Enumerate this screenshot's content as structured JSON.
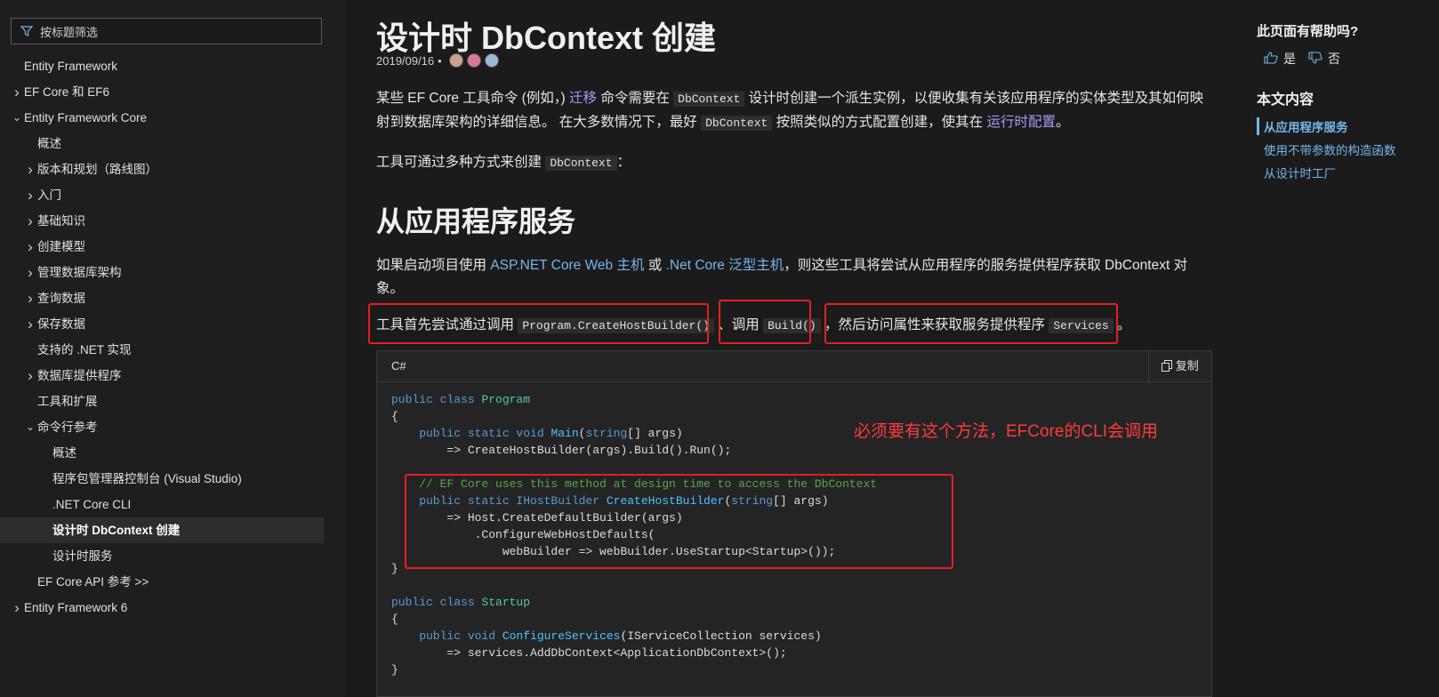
{
  "filter": {
    "placeholder": "按标题筛选",
    "icon": "filter-icon"
  },
  "nav": [
    {
      "label": "Entity Framework",
      "level": 0,
      "chevron": ""
    },
    {
      "label": "EF Core 和 EF6",
      "level": 0,
      "chevron": "right"
    },
    {
      "label": "Entity Framework Core",
      "level": 0,
      "chevron": "down"
    },
    {
      "label": "概述",
      "level": 1,
      "chevron": ""
    },
    {
      "label": "版本和规划（路线图）",
      "level": 1,
      "chevron": "right"
    },
    {
      "label": "入门",
      "level": 1,
      "chevron": "right"
    },
    {
      "label": "基础知识",
      "level": 1,
      "chevron": "right"
    },
    {
      "label": "创建模型",
      "level": 1,
      "chevron": "right"
    },
    {
      "label": "管理数据库架构",
      "level": 1,
      "chevron": "right"
    },
    {
      "label": "查询数据",
      "level": 1,
      "chevron": "right"
    },
    {
      "label": "保存数据",
      "level": 1,
      "chevron": "right"
    },
    {
      "label": "支持的 .NET 实现",
      "level": 1,
      "chevron": ""
    },
    {
      "label": "数据库提供程序",
      "level": 1,
      "chevron": "right"
    },
    {
      "label": "工具和扩展",
      "level": 1,
      "chevron": ""
    },
    {
      "label": "命令行参考",
      "level": 1,
      "chevron": "down"
    },
    {
      "label": "概述",
      "level": 2,
      "chevron": ""
    },
    {
      "label": "程序包管理器控制台 (Visual Studio)",
      "level": 2,
      "chevron": ""
    },
    {
      "label": ".NET Core CLI",
      "level": 2,
      "chevron": ""
    },
    {
      "label": "设计时 DbContext 创建",
      "level": 2,
      "chevron": "",
      "active": true
    },
    {
      "label": "设计时服务",
      "level": 2,
      "chevron": ""
    },
    {
      "label": "EF Core API 参考 >>",
      "level": 1,
      "chevron": ""
    },
    {
      "label": "Entity Framework 6",
      "level": 0,
      "chevron": "right"
    }
  ],
  "article": {
    "title": "设计时 DbContext 创建",
    "date": "2019/09/16",
    "bullet": "•",
    "intro": {
      "t1": "某些 EF Core 工具命令 (例如，) ",
      "link1": "迁移",
      "t2": " 命令需要在 ",
      "code1": "DbContext",
      "t3": " 设计时创建一个派生实例，以便收集有关该应用程序的实体类型及其如何映射到数据库架构的详细信息。 在大多数情况下，最好 ",
      "code2": "DbContext",
      "t4": " 按照类似的方式配置创建，使其在 ",
      "link2": "运行时配置",
      "t5": "。"
    },
    "ways": {
      "t1": "工具可通过多种方式来创建 ",
      "code": "DbContext",
      "t2": "："
    },
    "h2": "从应用程序服务",
    "para2": {
      "t1": "如果启动项目使用 ",
      "link1": "ASP.NET Core Web 主机",
      "t2": " 或 ",
      "link2": ".Net Core 泛型主机",
      "t3": "，则这些工具将尝试从应用程序的服务提供程序获取 DbContext 对象。"
    },
    "para3": {
      "t1": "工具首先尝试通过调用 ",
      "code1": "Program.CreateHostBuilder()",
      "t2": " 、调用 ",
      "code2": "Build()",
      "t3": " ，然后访问属性来获取服务提供程序 ",
      "code3": "Services",
      "t4": " 。"
    }
  },
  "code": {
    "lang": "C#",
    "copy": "复制",
    "annotation": "必须要有这个方法，EFCore的CLI会调用",
    "lines": {
      "l1": [
        "public class ",
        "Program"
      ],
      "l2": "{",
      "l3": [
        "    public static void ",
        "Main",
        "(",
        "string",
        "[] args)"
      ],
      "l4": "        => CreateHostBuilder(args).Build().Run();",
      "l6": "    // EF Core uses this method at design time to access the DbContext",
      "l7": [
        "    public static IHostBuilder ",
        "CreateHostBuilder",
        "(",
        "string",
        "[] args)"
      ],
      "l8": "        => Host.CreateDefaultBuilder(args)",
      "l9": "            .ConfigureWebHostDefaults(",
      "l10": "                webBuilder => webBuilder.UseStartup<Startup>());",
      "l11": "}",
      "l13": [
        "public class ",
        "Startup"
      ],
      "l14": "{",
      "l15": [
        "    public void ",
        "ConfigureServices",
        "(IServiceCollection services)"
      ],
      "l16": "        => services.AddDbContext<ApplicationDbContext>();",
      "l17": "}"
    }
  },
  "right": {
    "help_title": "此页面有帮助吗?",
    "yes": "是",
    "no": "否",
    "toc_title": "本文内容",
    "toc": [
      "从应用程序服务",
      "使用不带参数的构造函数",
      "从设计时工厂"
    ]
  },
  "colors": {
    "accent": "#75b6e7",
    "annotation": "#e22020",
    "background": "#1b1b1b"
  }
}
